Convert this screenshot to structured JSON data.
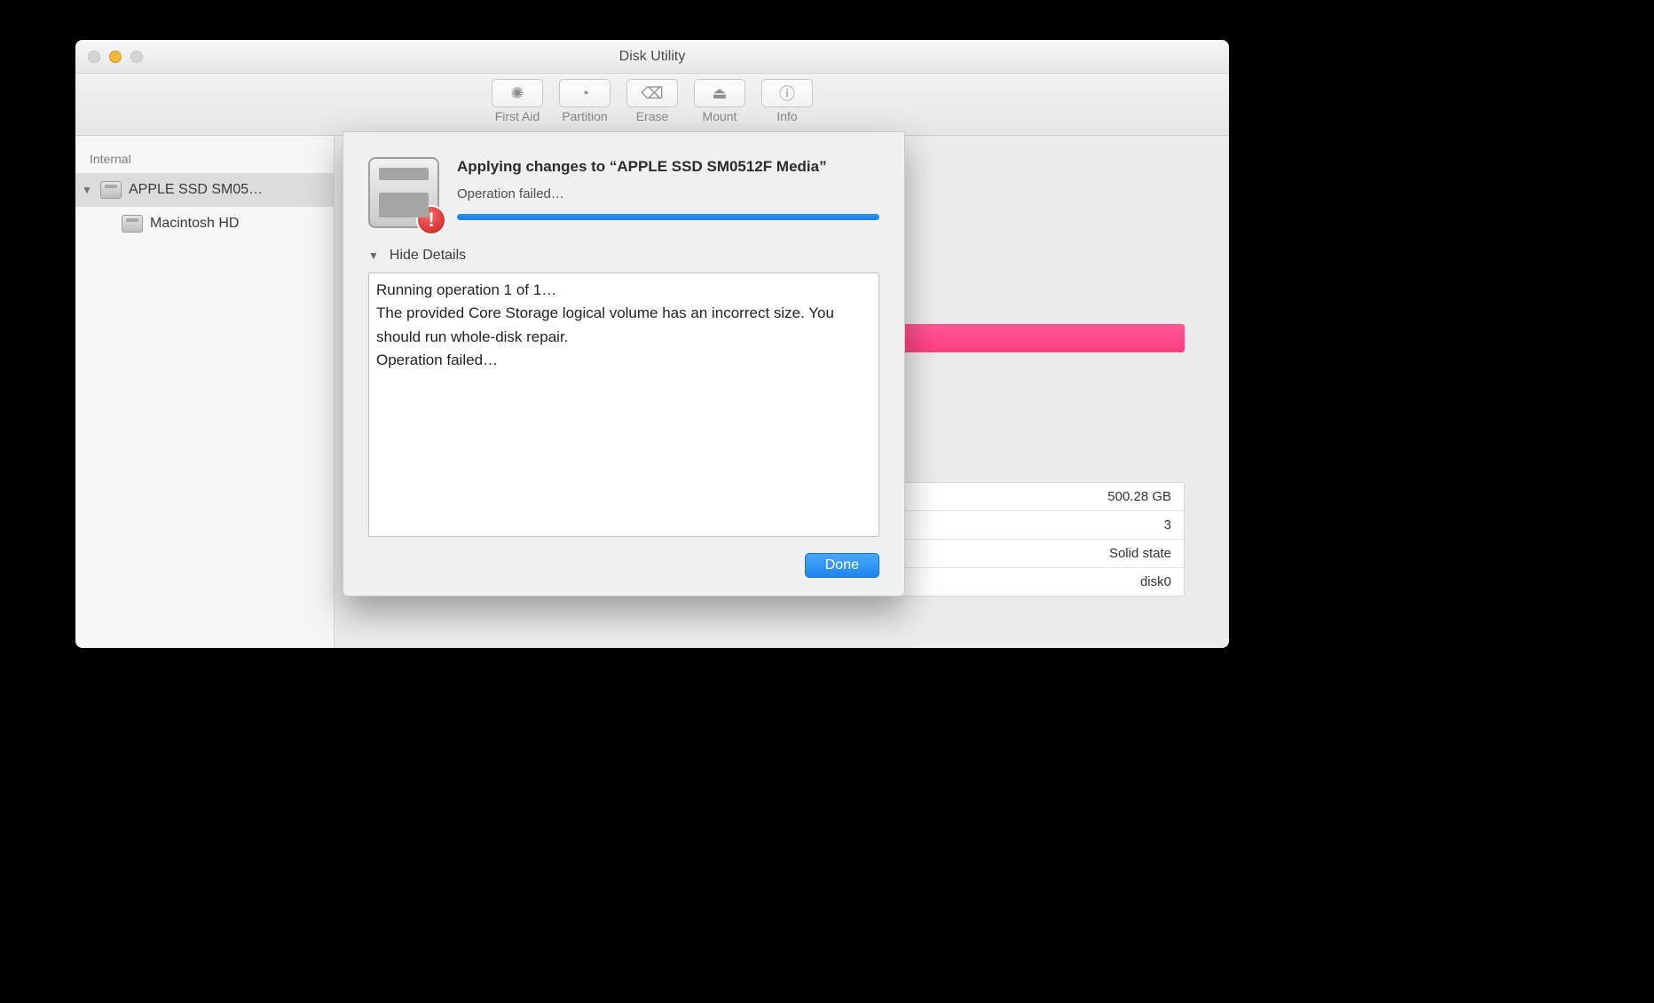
{
  "window": {
    "title": "Disk Utility"
  },
  "toolbar": {
    "first_aid": "First Aid",
    "partition": "Partition",
    "erase": "Erase",
    "mount": "Mount",
    "info": "Info"
  },
  "sidebar": {
    "header": "Internal",
    "items": [
      {
        "label": "APPLE SSD SM05…",
        "selected": true
      },
      {
        "label": "Macintosh HD",
        "selected": false
      }
    ]
  },
  "info_panel": {
    "rows": [
      {
        "value": "500.28 GB"
      },
      {
        "value": "3"
      },
      {
        "value": "Solid state"
      },
      {
        "value": "disk0"
      }
    ]
  },
  "sheet": {
    "title": "Applying changes to “APPLE SSD SM0512F Media”",
    "subtitle": "Operation failed…",
    "details_toggle": "Hide Details",
    "log_lines": [
      "Running operation 1 of 1…",
      "The provided Core Storage logical volume has an incorrect size. You should run whole-disk repair.",
      "Operation failed…"
    ],
    "done": "Done",
    "alert_glyph": "!"
  }
}
